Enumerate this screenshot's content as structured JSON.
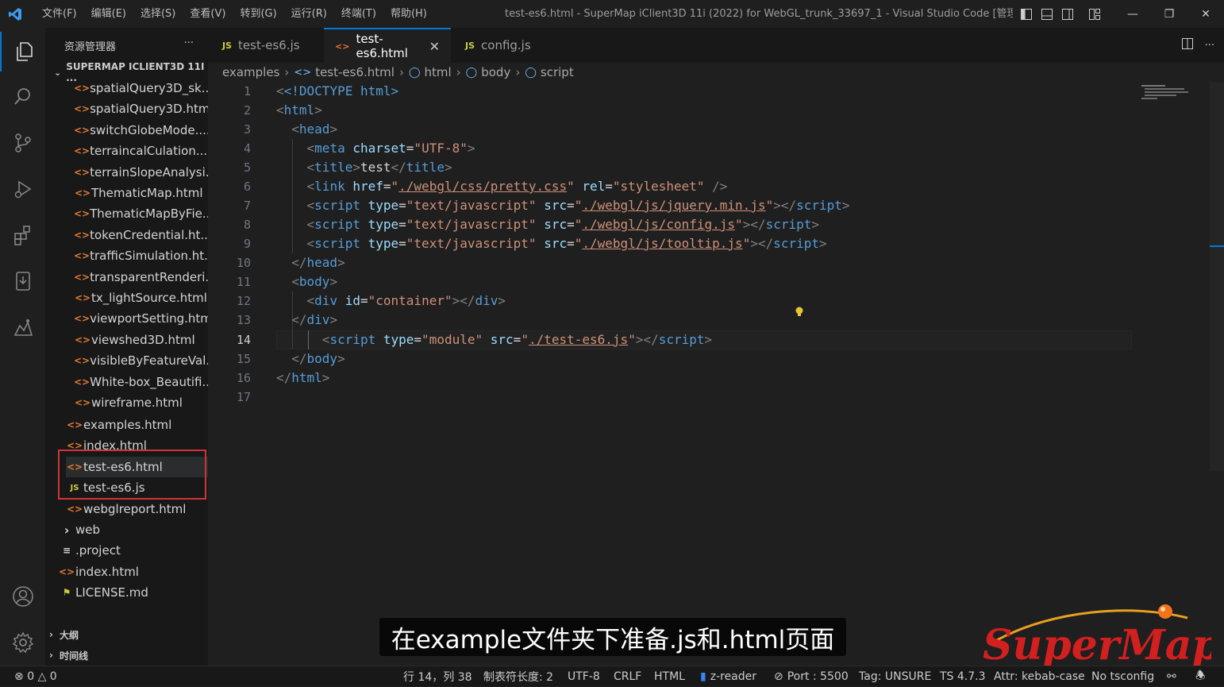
{
  "menu": [
    "文件(F)",
    "编辑(E)",
    "选择(S)",
    "查看(V)",
    "转到(G)",
    "运行(R)",
    "终端(T)",
    "帮助(H)"
  ],
  "window_title": "test-es6.html - SuperMap iClient3D 11i (2022) for WebGL_trunk_33697_1 - Visual Studio Code [管理...",
  "sidebar": {
    "header": "资源管理器",
    "project": "SUPERMAP ICLIENT3D 11I ...",
    "files": [
      {
        "name": "spatialQuery3D_sk...",
        "type": "html"
      },
      {
        "name": "spatialQuery3D.html",
        "type": "html"
      },
      {
        "name": "switchGlobeMode....",
        "type": "html"
      },
      {
        "name": "terraincalCulation....",
        "type": "html"
      },
      {
        "name": "terrainSlopeAnalysi...",
        "type": "html"
      },
      {
        "name": "ThematicMap.html",
        "type": "html"
      },
      {
        "name": "ThematicMapByFie...",
        "type": "html"
      },
      {
        "name": "tokenCredential.ht...",
        "type": "html"
      },
      {
        "name": "trafficSimulation.ht...",
        "type": "html"
      },
      {
        "name": "transparentRenderi...",
        "type": "html"
      },
      {
        "name": "tx_lightSource.html",
        "type": "html"
      },
      {
        "name": "viewportSetting.html",
        "type": "html"
      },
      {
        "name": "viewshed3D.html",
        "type": "html"
      },
      {
        "name": "visibleByFeatureVal...",
        "type": "html"
      },
      {
        "name": "White-box_Beautifi...",
        "type": "html"
      },
      {
        "name": "wireframe.html",
        "type": "html"
      }
    ],
    "examples_files": [
      {
        "name": "examples.html",
        "type": "html"
      },
      {
        "name": "index.html",
        "type": "html"
      },
      {
        "name": "test-es6.html",
        "type": "html"
      },
      {
        "name": "test-es6.js",
        "type": "js"
      },
      {
        "name": "webglreport.html",
        "type": "html"
      }
    ],
    "root_items": [
      {
        "name": "web",
        "type": "folder"
      },
      {
        "name": ".project",
        "type": "file"
      },
      {
        "name": "index.html",
        "type": "html"
      },
      {
        "name": "LICENSE.md",
        "type": "md"
      }
    ],
    "outline": "大纲",
    "timeline": "时间线"
  },
  "tabs": [
    {
      "label": "test-es6.js",
      "icon": "JS"
    },
    {
      "label": "test-es6.html",
      "icon": "<>"
    },
    {
      "label": "config.js",
      "icon": "JS"
    }
  ],
  "breadcrumbs": [
    "examples",
    "test-es6.html",
    "html",
    "body",
    "script"
  ],
  "line_numbers": [
    "1",
    "2",
    "3",
    "4",
    "5",
    "6",
    "7",
    "8",
    "9",
    "10",
    "11",
    "12",
    "13",
    "14",
    "15",
    "16",
    "17"
  ],
  "code": {
    "doctype": "<!DOCTYPE html>",
    "html_open": "<html>",
    "head_open": "<head>",
    "meta_charset": "UTF-8",
    "title_text": "test",
    "css_href": "./webgl/css/pretty.css",
    "css_rel": "stylesheet",
    "script_type": "text/javascript",
    "src_jquery": "./webgl/js/jquery.min.js",
    "src_config": "./webgl/js/config.js",
    "src_tooltip": "./webgl/js/tooltip.js",
    "div_id": "container",
    "module_type": "module",
    "module_src": "./test-es6.js"
  },
  "subtitle": "在example文件夹下准备.js和.html页面",
  "logo_text": "SuperMap",
  "status": {
    "errors": "0",
    "warnings": "0",
    "position": "行 14，列 38",
    "tab_size": "制表符长度: 2",
    "encoding": "UTF-8",
    "eol": "CRLF",
    "language": "HTML",
    "reader": "z-reader",
    "port": "Port : 5500",
    "tag": "Tag: UNSURE",
    "ts": "TS 4.7.3",
    "attr": "Attr: kebab-case",
    "tsconfig": "No tsconfig"
  },
  "colors": {
    "accent": "#0078d4",
    "html_icon": "#e37933",
    "js_icon": "#cbcb41",
    "highlight_box": "#d13438"
  }
}
